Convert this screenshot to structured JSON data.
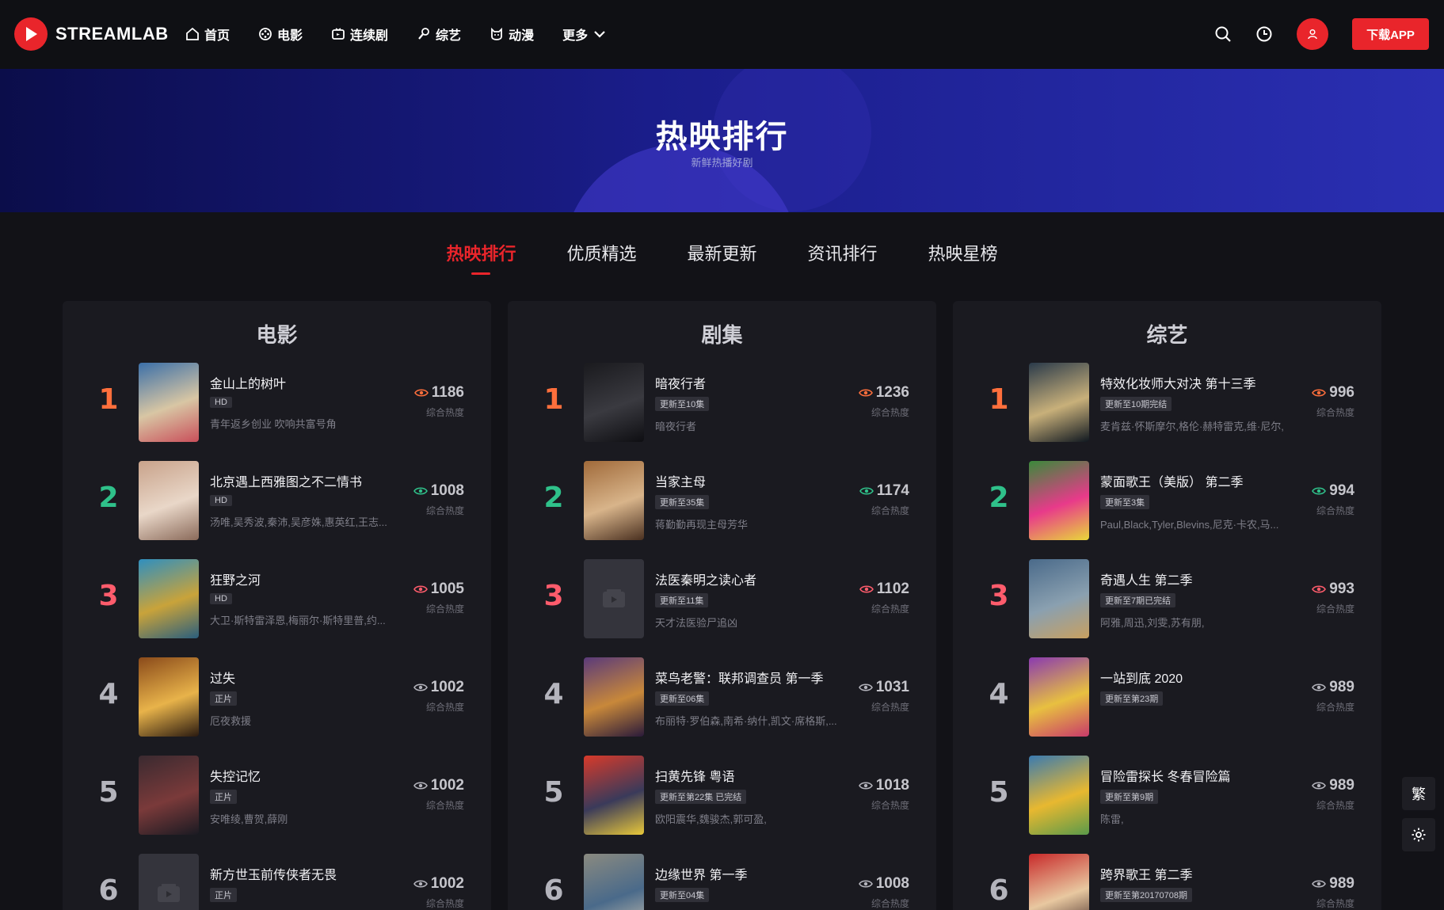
{
  "header": {
    "logo_text": "STREAMLAB",
    "nav": [
      {
        "label": "首页",
        "icon": "home-icon"
      },
      {
        "label": "电影",
        "icon": "film-reel-icon"
      },
      {
        "label": "连续剧",
        "icon": "tv-icon"
      },
      {
        "label": "综艺",
        "icon": "mic-icon"
      },
      {
        "label": "动漫",
        "icon": "anime-icon"
      },
      {
        "label": "更多",
        "icon": "chevron-down-icon"
      }
    ],
    "download_label": "下载APP"
  },
  "hero": {
    "title": "热映排行",
    "subtitle": "新鲜热播好剧"
  },
  "tabs": [
    "热映排行",
    "优质精选",
    "最新更新",
    "资讯排行",
    "热映星榜"
  ],
  "heat_label": "综合热度",
  "panels": [
    {
      "title": "电影",
      "items": [
        {
          "rank": "1",
          "title": "金山上的树叶",
          "badge": "HD",
          "desc": "青年返乡创业 吹响共富号角",
          "heat": "1186"
        },
        {
          "rank": "2",
          "title": "北京遇上西雅图之不二情书",
          "badge": "HD",
          "desc": "汤唯,吴秀波,秦沛,吴彦姝,惠英红,王志...",
          "heat": "1008"
        },
        {
          "rank": "3",
          "title": "狂野之河",
          "badge": "HD",
          "desc": "大卫·斯特雷泽恩,梅丽尔·斯特里普,约...",
          "heat": "1005"
        },
        {
          "rank": "4",
          "title": "过失",
          "badge": "正片",
          "desc": "厄夜救援",
          "heat": "1002"
        },
        {
          "rank": "5",
          "title": "失控记忆",
          "badge": "正片",
          "desc": "安唯绫,曹贺,薛刚",
          "heat": "1002"
        },
        {
          "rank": "6",
          "title": "新方世玉前传侠者无畏",
          "badge": "正片",
          "desc": "",
          "heat": "1002"
        }
      ]
    },
    {
      "title": "剧集",
      "items": [
        {
          "rank": "1",
          "title": "暗夜行者",
          "badge": "更新至10集",
          "desc": "暗夜行者",
          "heat": "1236"
        },
        {
          "rank": "2",
          "title": "当家主母",
          "badge": "更新至35集",
          "desc": "蒋勤勤再现主母芳华",
          "heat": "1174"
        },
        {
          "rank": "3",
          "title": "法医秦明之读心者",
          "badge": "更新至11集",
          "desc": "天才法医验尸追凶",
          "heat": "1102"
        },
        {
          "rank": "4",
          "title": "菜鸟老警：联邦调查员 第一季",
          "badge": "更新至06集",
          "desc": "布丽特·罗伯森,南希·纳什,凯文·席格斯,...",
          "heat": "1031"
        },
        {
          "rank": "5",
          "title": "扫黄先锋 粤语",
          "badge": "更新至第22集 已完结",
          "desc": "欧阳震华,魏骏杰,郭可盈,",
          "heat": "1018"
        },
        {
          "rank": "6",
          "title": "边缘世界 第一季",
          "badge": "更新至04集",
          "desc": "",
          "heat": "1008"
        }
      ]
    },
    {
      "title": "综艺",
      "items": [
        {
          "rank": "1",
          "title": "特效化妆师大对决 第十三季",
          "badge": "更新至10期完结",
          "desc": "麦肯兹·怀斯摩尔,格伦·赫特雷克,维·尼尔,",
          "heat": "996"
        },
        {
          "rank": "2",
          "title": "蒙面歌王（美版） 第二季",
          "badge": "更新至3集",
          "desc": "Paul,Black,Tyler,Blevins,尼克·卡农,马...",
          "heat": "994"
        },
        {
          "rank": "3",
          "title": "奇遇人生 第二季",
          "badge": "更新至7期已完结",
          "desc": "阿雅,周迅,刘雯,苏有朋,",
          "heat": "993"
        },
        {
          "rank": "4",
          "title": "一站到底 2020",
          "badge": "更新至第23期",
          "desc": "",
          "heat": "989"
        },
        {
          "rank": "5",
          "title": "冒险雷探长 冬春冒险篇",
          "badge": "更新至第9期",
          "desc": "陈雷,",
          "heat": "989"
        },
        {
          "rank": "6",
          "title": "跨界歌王 第二季",
          "badge": "更新至第20170708期",
          "desc": "",
          "heat": "989"
        }
      ]
    }
  ],
  "side_buttons": {
    "traditional": "繁"
  },
  "colors": {
    "accent": "#e9252b",
    "rank1": "#ff6f3c",
    "rank2": "#2fc18a",
    "rank3": "#ff5c6c"
  }
}
